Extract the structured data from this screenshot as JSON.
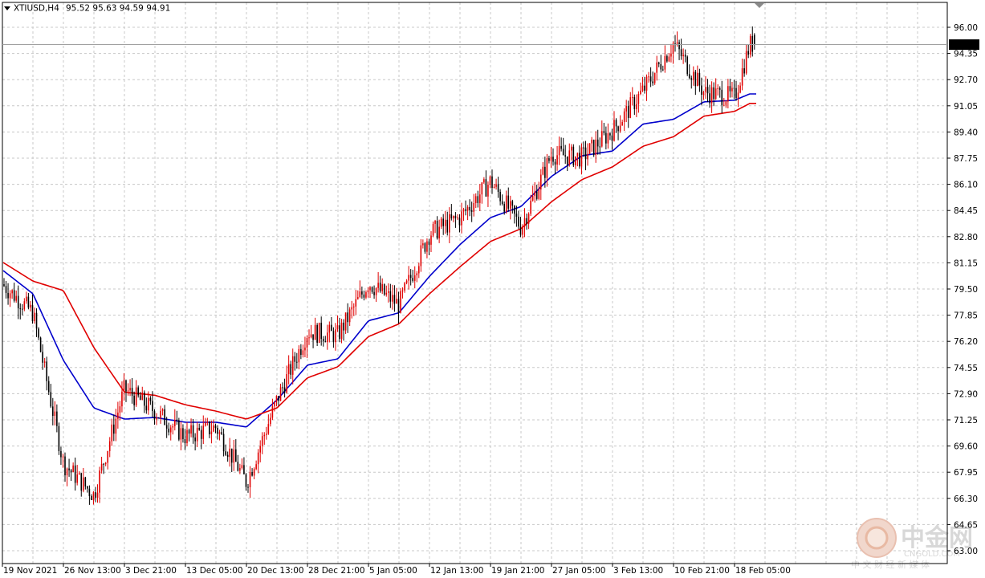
{
  "header": {
    "symbol": "XTIUSD,H4",
    "ohlc": "95.52 95.63 94.59 94.91"
  },
  "current_price": "94.91",
  "watermark": {
    "brand": "中金网",
    "domain": "CNGOLD.COM",
    "tagline": "中 文 财 经 新 媒 体"
  },
  "colors": {
    "background": "#ffffff",
    "grid": "#c8c8c8",
    "bull_candle": "#e00000",
    "bear_candle": "#000000",
    "ma_fast": "#0000cc",
    "ma_slow": "#e00000",
    "price_label_bg": "#000000"
  },
  "chart_data": {
    "type": "candlestick",
    "symbol": "XTIUSD",
    "timeframe": "H4",
    "x_tick_labels": [
      "19 Nov 2021",
      "26 Nov 13:00",
      "3 Dec 21:00",
      "13 Dec 05:00",
      "20 Dec 13:00",
      "28 Dec 21:00",
      "5 Jan 05:00",
      "12 Jan 13:00",
      "19 Jan 21:00",
      "27 Jan 05:00",
      "3 Feb 13:00",
      "10 Feb 21:00",
      "18 Feb 05:00"
    ],
    "y_tick_labels": [
      "96.00",
      "94.35",
      "92.70",
      "91.05",
      "89.40",
      "87.75",
      "86.10",
      "84.45",
      "82.80",
      "81.15",
      "79.50",
      "77.85",
      "76.20",
      "74.55",
      "72.90",
      "71.25",
      "69.60",
      "67.95",
      "66.30",
      "64.65",
      "63.00"
    ],
    "ylim": [
      63.0,
      96.0
    ],
    "grid": true,
    "last_price": 94.91,
    "last_ohlc": {
      "open": 95.52,
      "high": 95.63,
      "low": 94.59,
      "close": 94.91
    },
    "series": [
      {
        "kind": "ohlc-closes",
        "x_label_index": [
          0,
          0.5,
          1,
          1.5,
          2,
          2.5,
          3,
          3.5,
          4,
          4.5,
          5,
          5.5,
          6,
          6.5,
          7,
          7.5,
          8,
          8.5,
          9,
          9.5,
          10,
          10.5,
          11,
          11.5,
          12,
          12.25
        ],
        "close": [
          79.8,
          78.0,
          68.5,
          66.5,
          73.2,
          71.8,
          70.2,
          70.8,
          67.3,
          72.5,
          76.8,
          76.6,
          79.9,
          78.5,
          83.0,
          84.0,
          86.3,
          83.4,
          88.0,
          87.8,
          89.5,
          92.0,
          95.0,
          91.9,
          91.6,
          94.91
        ]
      },
      {
        "kind": "moving-average",
        "x_label_index": [
          0,
          0.5,
          1,
          1.5,
          2,
          2.5,
          3,
          3.5,
          4,
          4.5,
          5,
          5.5,
          6,
          6.5,
          7,
          7.5,
          8,
          8.5,
          9,
          9.5,
          10,
          10.5,
          11,
          11.5,
          12,
          12.25
        ],
        "values": [
          80.7,
          79.2,
          75.0,
          72.0,
          71.3,
          71.4,
          71.1,
          71.1,
          70.8,
          72.5,
          74.7,
          75.1,
          77.5,
          78.0,
          80.3,
          82.3,
          84.0,
          84.7,
          86.6,
          87.9,
          88.2,
          89.9,
          90.2,
          91.3,
          91.4,
          91.8
        ]
      },
      {
        "kind": "moving-average",
        "x_label_index": [
          0,
          0.5,
          1,
          1.5,
          2,
          2.5,
          3,
          3.5,
          4,
          4.5,
          5,
          5.5,
          6,
          6.5,
          7,
          7.5,
          8,
          8.5,
          9,
          9.5,
          10,
          10.5,
          11,
          11.5,
          12,
          12.25
        ],
        "values": [
          81.2,
          80.0,
          79.4,
          75.8,
          73.0,
          72.8,
          72.2,
          71.8,
          71.3,
          72.0,
          73.9,
          74.6,
          76.5,
          77.3,
          79.2,
          80.9,
          82.5,
          83.3,
          85.0,
          86.4,
          87.2,
          88.5,
          89.1,
          90.4,
          90.7,
          91.2
        ]
      }
    ]
  }
}
